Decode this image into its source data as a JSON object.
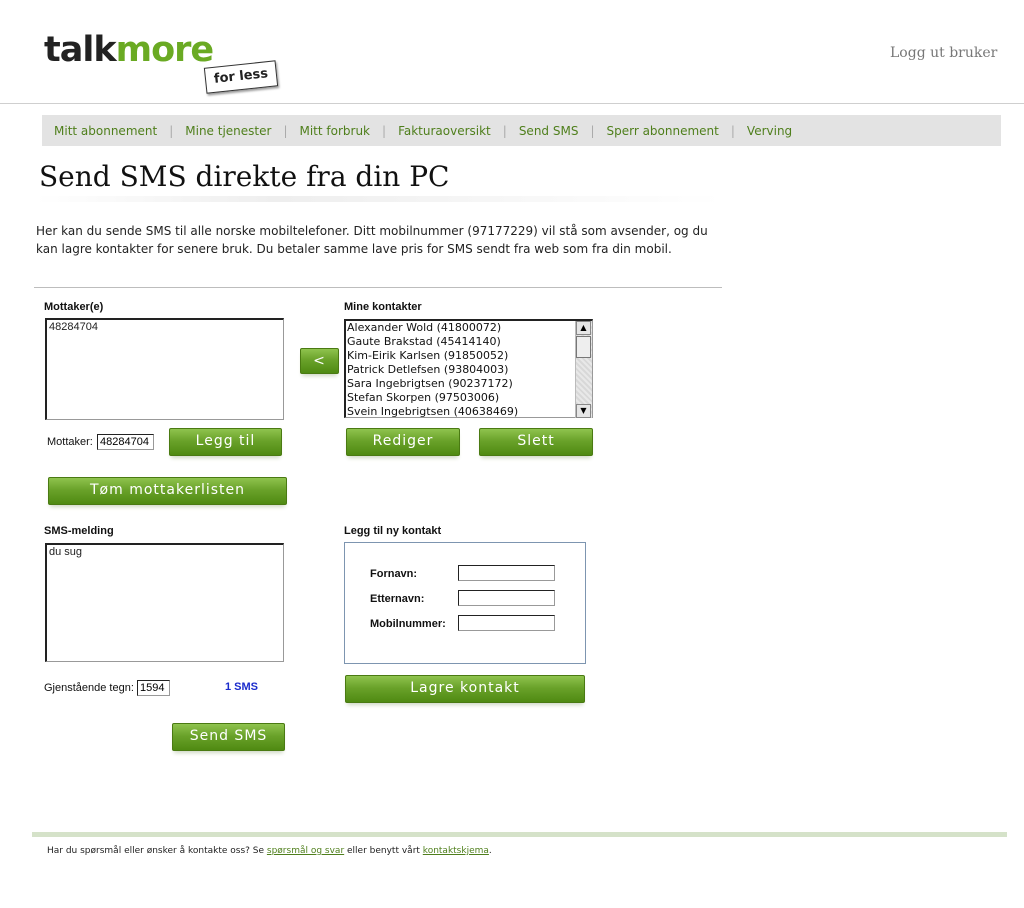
{
  "header": {
    "logo_part1": "talk",
    "logo_part2": "more",
    "logo_tagline": "for less",
    "logout_label": "Logg ut bruker"
  },
  "nav": {
    "items": [
      "Mitt abonnement",
      "Mine tjenester",
      "Mitt forbruk",
      "Fakturaoversikt",
      "Send SMS",
      "Sperr abonnement",
      "Verving"
    ]
  },
  "page": {
    "title": "Send SMS direkte fra din PC",
    "intro": "Her kan du sende SMS til alle norske mobiltelefoner. Ditt mobilnummer (97177229) vil stå som avsender, og du kan lagre kontakter for senere bruk. Du betaler samme lave pris for SMS sendt fra web som fra din mobil."
  },
  "recipients": {
    "heading": "Mottaker(e)",
    "list_value": "48284704",
    "input_label": "Mottaker:",
    "input_value": "48284704",
    "add_button": "Legg til",
    "clear_button": "Tøm mottakerlisten",
    "move_button": "<"
  },
  "contacts": {
    "heading": "Mine kontakter",
    "items": [
      "Alexander Wold (41800072)",
      "Gaute Brakstad (45414140)",
      "Kim-Eirik Karlsen (91850052)",
      "Patrick Detlefsen (93804003)",
      "Sara Ingebrigtsen (90237172)",
      "Stefan Skorpen (97503006)",
      "Svein Ingebrigtsen (40638469)"
    ],
    "edit_button": "Rediger",
    "delete_button": "Slett"
  },
  "sms": {
    "heading": "SMS-melding",
    "message": "du sug",
    "remaining_label": "Gjenstående tegn:",
    "remaining_value": "1594",
    "count": "1 SMS",
    "send_button": "Send SMS"
  },
  "new_contact": {
    "heading": "Legg til ny kontakt",
    "first_name_label": "Fornavn:",
    "last_name_label": "Etternavn:",
    "mobile_label": "Mobilnummer:",
    "first_name_value": "",
    "last_name_value": "",
    "mobile_value": "",
    "save_button": "Lagre kontakt"
  },
  "footer": {
    "text_before": "Har du spørsmål eller ønsker å kontakte oss? Se ",
    "link1": "spørsmål og svar",
    "text_middle": " eller benytt vårt ",
    "link2": "kontaktskjema",
    "text_after": "."
  },
  "colors": {
    "brand_green": "#6aaa23",
    "nav_link": "#4f7f1c",
    "sms_count": "#1a2bcc"
  }
}
